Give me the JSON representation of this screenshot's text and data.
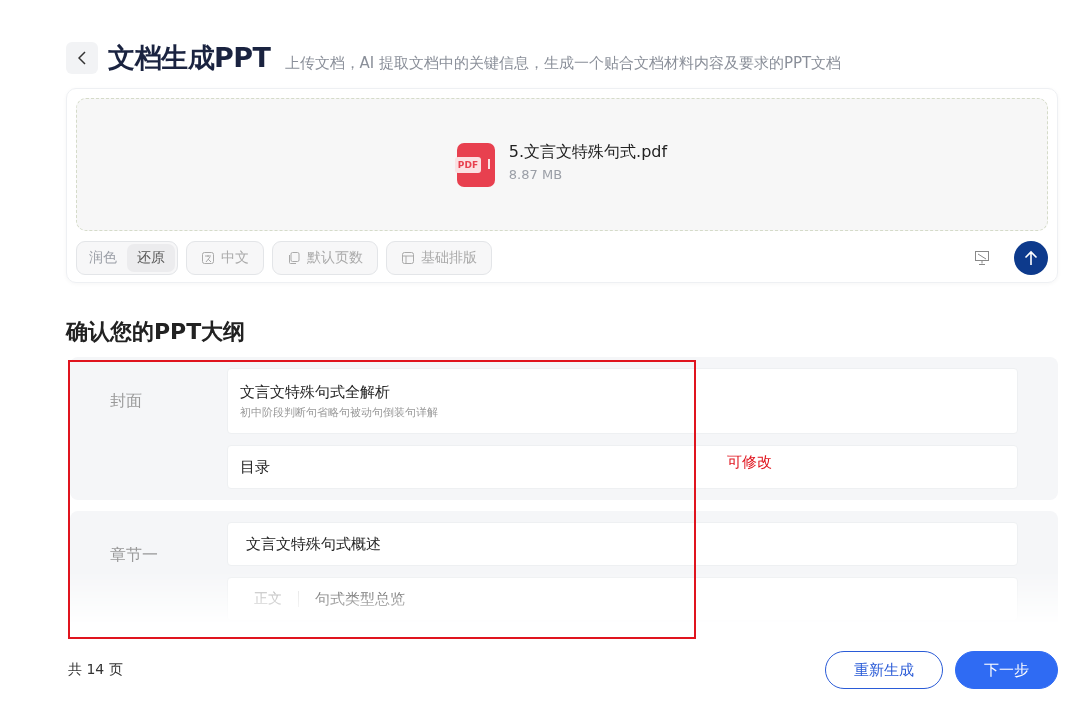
{
  "header": {
    "title": "文档生成PPT",
    "description": "上传文档，AI 提取文档中的关键信息，生成一个贴合文档材料内容及要求的PPT文档"
  },
  "upload": {
    "file": {
      "badge": "PDF",
      "name": "5.文言文特殊句式.pdf",
      "size": "8.87 MB"
    },
    "mode_toggle": [
      {
        "label": "润色",
        "selected": false
      },
      {
        "label": "还原",
        "selected": true
      }
    ],
    "options": [
      {
        "kind": "language",
        "label": "中文"
      },
      {
        "kind": "pages",
        "label": "默认页数"
      },
      {
        "kind": "layout",
        "label": "基础排版"
      }
    ]
  },
  "outline": {
    "heading": "确认您的PPT大纲",
    "sections": [
      {
        "label": "封面",
        "items": [
          {
            "kind": "title",
            "text": "文言文特殊句式全解析",
            "subtitle": "初中阶段判断句省略句被动句倒装句详解"
          },
          {
            "kind": "plain",
            "text": "目录"
          }
        ]
      },
      {
        "label": "章节一",
        "items": [
          {
            "kind": "chapter",
            "text": "文言文特殊句式概述"
          },
          {
            "kind": "body",
            "tag": "正文",
            "text": "句式类型总览"
          }
        ]
      }
    ]
  },
  "annotation": {
    "text": "可修改"
  },
  "footer": {
    "page_count": "共 14 页",
    "buttons": [
      {
        "kind": "secondary",
        "label": "重新生成"
      },
      {
        "kind": "primary",
        "label": "下一步"
      }
    ]
  }
}
